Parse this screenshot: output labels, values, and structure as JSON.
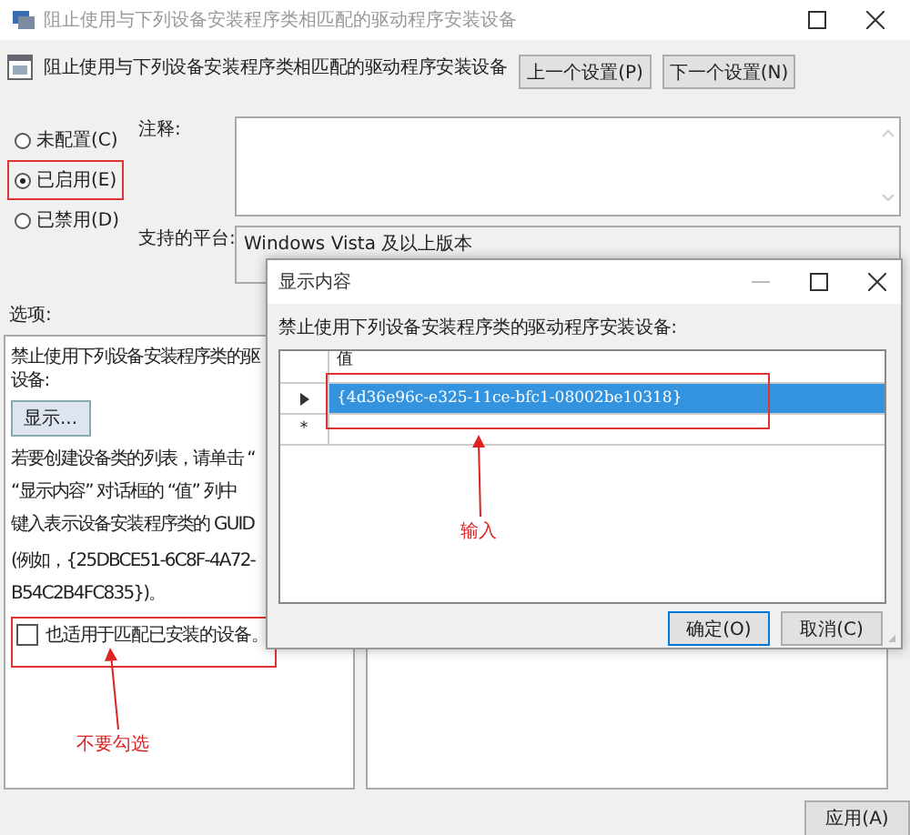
{
  "window": {
    "title": "阻止使用与下列设备安装程序类相匹配的驱动程序安装设备"
  },
  "header": {
    "policy_name": "阻止使用与下列设备安装程序类相匹配的驱动程序安装设备",
    "buttons": [
      "上一个设置(P)",
      "下一个设置(N)"
    ]
  },
  "state_options": [
    {
      "label": "未配置(C)",
      "selected": false,
      "highlighted": false
    },
    {
      "label": "已启用(E)",
      "selected": true,
      "highlighted": true
    },
    {
      "label": "已禁用(D)",
      "selected": false,
      "highlighted": false
    }
  ],
  "comment": {
    "label": "注释:"
  },
  "platform": {
    "label": "支持的平台:",
    "value": "Windows Vista 及以上版本"
  },
  "options": {
    "label": "选项:",
    "intro": [
      "禁止使用下列设备安装程序类的驱",
      "设备:"
    ],
    "show_button": "显示...",
    "help": [
      "若要创建设备类的列表，请单击 “",
      "“显示内容” 对话框的 “值” 列中",
      "键入表示设备安装程序类的 GUID",
      "(例如，{25DBCE51-6C8F-4A72-",
      "B54C2B4FC835})。"
    ],
    "checkbox": {
      "label": "也适用于匹配已安装的设备。",
      "checked": false,
      "highlighted": true
    }
  },
  "dialog": {
    "title": "显示内容",
    "prompt": "禁止使用下列设备安装程序类的驱动程序安装设备:",
    "column": "值",
    "highlighted": true,
    "rows": [
      {
        "kind": "current",
        "value": "{4d36e96c-e325-11ce-bfc1-08002be10318}",
        "selected": true
      },
      {
        "kind": "new",
        "marker": "*",
        "selected": false
      }
    ],
    "buttons": [
      "确定(O)",
      "取消(C)"
    ]
  },
  "annotations": [
    {
      "kind": "grid",
      "text": "输入"
    },
    {
      "kind": "checkbox",
      "text": "不要勾选"
    }
  ],
  "footer_buttons": [
    "应用(A)"
  ]
}
